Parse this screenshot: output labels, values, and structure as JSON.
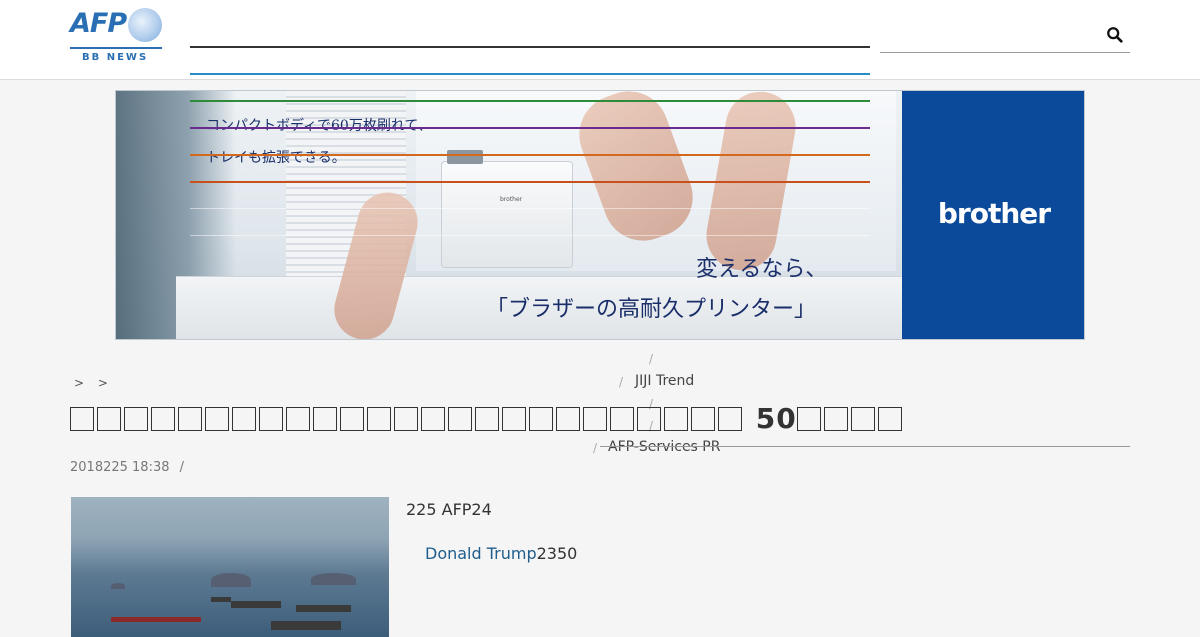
{
  "header": {
    "logo_text": "AFP",
    "logo_sub": "BB NEWS",
    "search_icon": "search-icon"
  },
  "ad": {
    "copy_line1": "コンパクトボディで60万枚刷れて、",
    "copy_line2": "トレイも拡張できる。",
    "tagline1": "変えるなら、",
    "tagline2": "「ブラザーの高耐久プリンター」",
    "brand": "brother",
    "printer_label": "brother"
  },
  "breadcrumb": {
    "sep1": ">",
    "sep2": ">"
  },
  "overlay_menu": {
    "item1": "JIJI Trend",
    "item2": "AFP-Services PR"
  },
  "article": {
    "title_tail": "50",
    "date": "2018225 18:38",
    "meta_sep": "/",
    "lead": "225 AFP24",
    "link_text": "Donald Trump",
    "after_link": "2350"
  },
  "colors": {
    "accent": "#2a6fb4",
    "nav_line_dark": "#333333",
    "nav_line_blue": "#2a8ac4",
    "line_green": "#2e8b3a",
    "line_purple": "#6a2b8f",
    "line_orange": "#d2691e",
    "brand_blue": "#0b4a9a"
  }
}
